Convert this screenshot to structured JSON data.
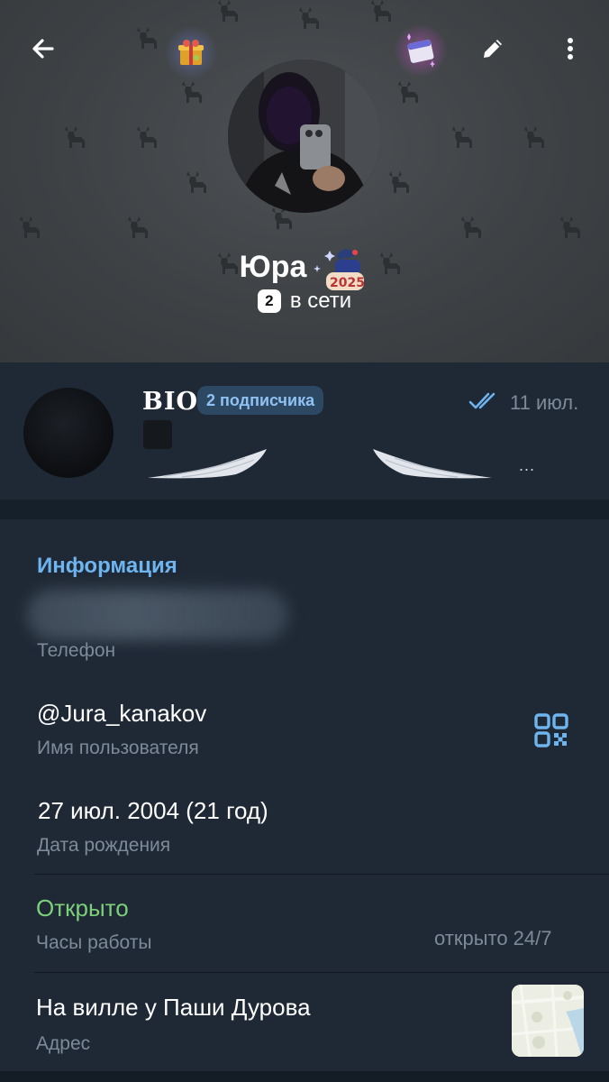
{
  "header": {
    "name": "Юра",
    "online_count": "2",
    "status_text": "в сети"
  },
  "channel": {
    "title": "BIO",
    "subscribers": "2 подписчика",
    "date": "11 июл.",
    "preview_ellipsis": "..."
  },
  "info": {
    "heading": "Информация",
    "phone_label": "Телефон",
    "username_value": "@Jura_kanakov",
    "username_label": "Имя пользователя",
    "birthday_value": "27 июл. 2004 (21 год)",
    "birthday_label": "Дата рождения",
    "hours_value": "Открыто",
    "hours_label": "Часы работы",
    "hours_detail": "открыто 24/7",
    "address_value": "На вилле у Паши Дурова",
    "address_label": "Адрес"
  },
  "colors": {
    "accent": "#6eb4ef",
    "open_green": "#7cd07a",
    "panel": "#1f2936",
    "muted": "#7d8b99"
  },
  "icons": {
    "back": "arrow-left-icon",
    "edit": "pencil-icon",
    "menu": "more-vertical-icon",
    "qr": "qr-code-icon",
    "read": "double-check-icon"
  }
}
